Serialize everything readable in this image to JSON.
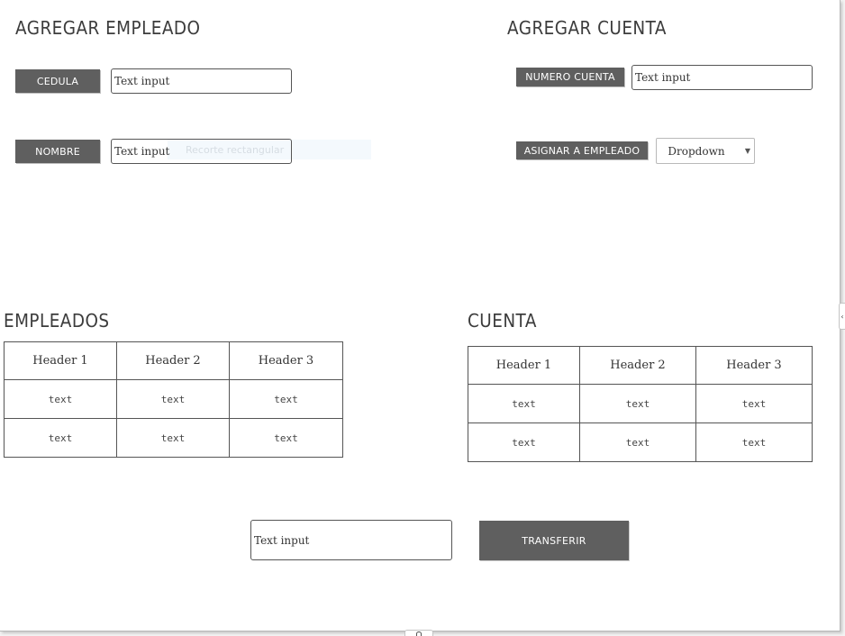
{
  "agregar_empleado": {
    "title": "AGREGAR EMPLEADO",
    "cedula_label": "CEDULA",
    "cedula_placeholder": "Text input",
    "nombre_label": "NOMBRE",
    "nombre_placeholder": "Text input",
    "ghost_overlay": "Recorte rectangular"
  },
  "agregar_cuenta": {
    "title": "AGREGAR CUENTA",
    "numero_label": "NUMERO CUENTA",
    "numero_placeholder": "Text input",
    "asignar_label": "ASIGNAR A EMPLEADO",
    "dropdown_value": "Dropdown",
    "dropdown_icon": "triangle-down"
  },
  "empleados": {
    "title": "EMPLEADOS",
    "headers": [
      "Header 1",
      "Header 2",
      "Header 3"
    ],
    "rows": [
      [
        "text",
        "text",
        "text"
      ],
      [
        "text",
        "text",
        "text"
      ]
    ]
  },
  "cuenta": {
    "title": "CUENTA",
    "headers": [
      "Header 1",
      "Header 2",
      "Header 3"
    ],
    "rows": [
      [
        "text",
        "text",
        "text"
      ],
      [
        "text",
        "text",
        "text"
      ]
    ]
  },
  "transfer": {
    "amount_placeholder": "Text input",
    "button_label": "TRANSFERIR"
  },
  "colors": {
    "label_bg": "#5f5f5f",
    "canvas_bg": "#ffffff",
    "border": "#555555"
  }
}
